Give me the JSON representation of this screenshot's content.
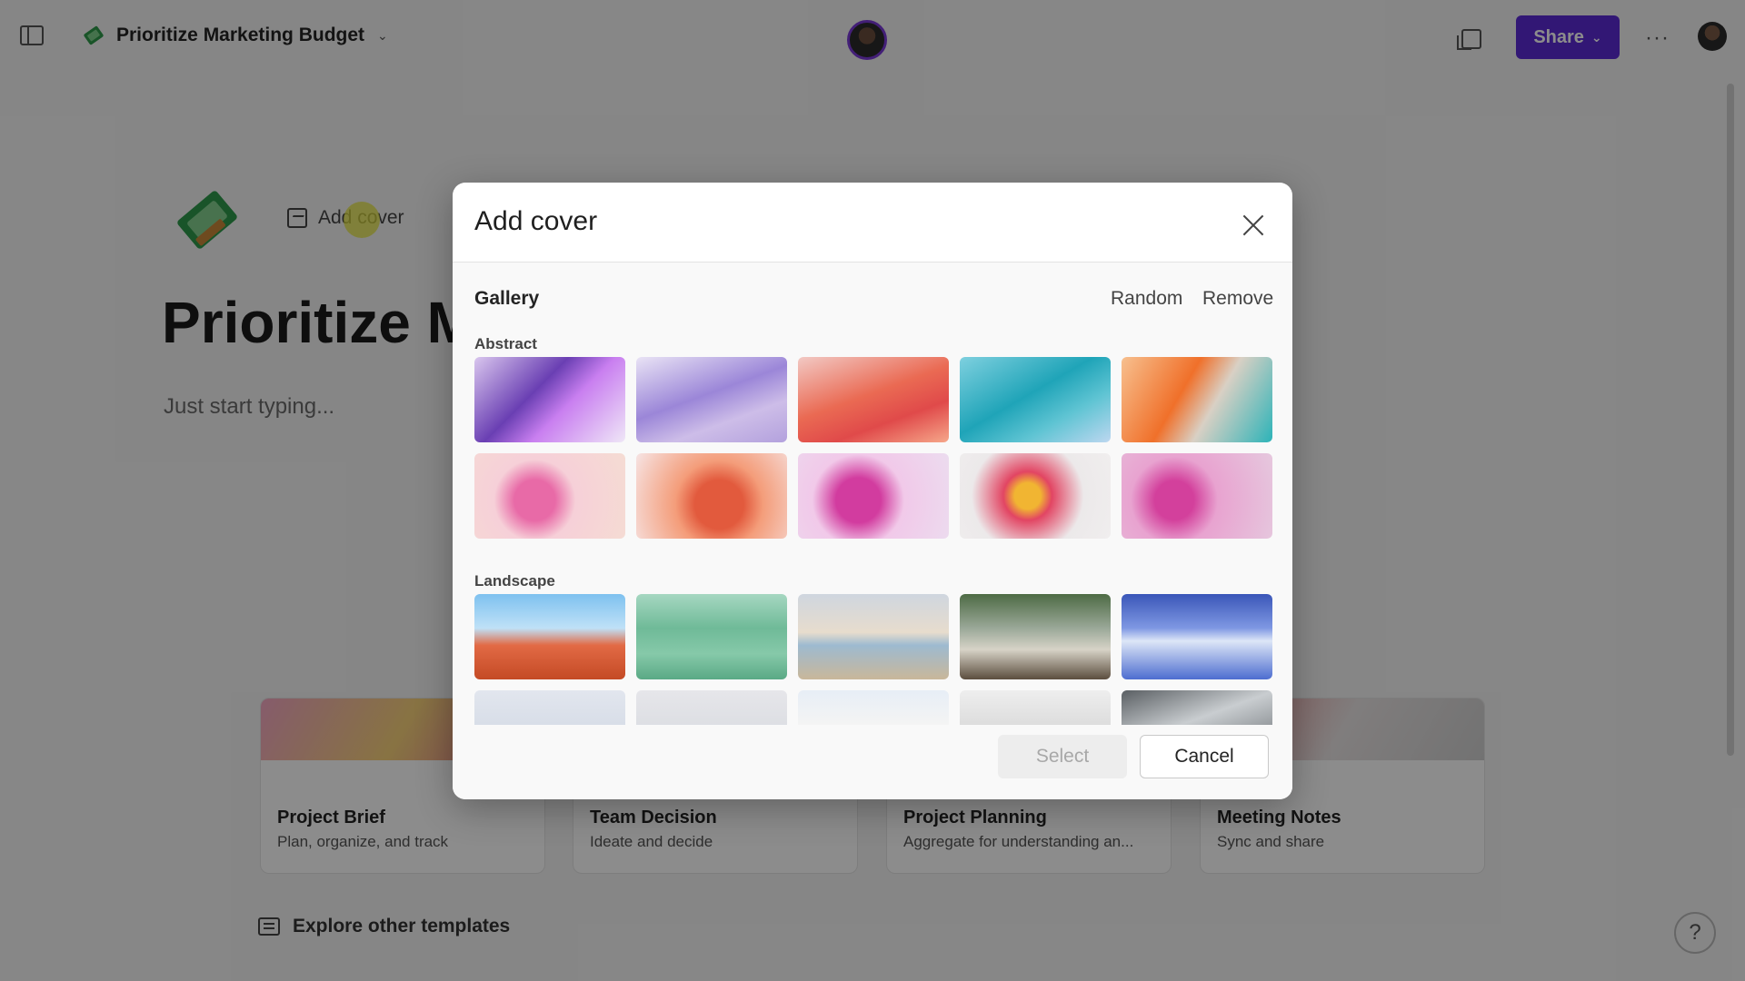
{
  "topbar": {
    "doc_title": "Prioritize Marketing Budget",
    "share_label": "Share"
  },
  "page": {
    "add_cover_label": "Add cover",
    "heading": "Prioritize Marketing Budget",
    "placeholder": "Just start typing..."
  },
  "templates": [
    {
      "title": "Project Brief",
      "desc": "Plan, organize, and track"
    },
    {
      "title": "Team Decision",
      "desc": "Ideate and decide"
    },
    {
      "title": "Project Planning",
      "desc": "Aggregate for understanding an..."
    },
    {
      "title": "Meeting Notes",
      "desc": "Sync and share"
    }
  ],
  "explore_label": "Explore other templates",
  "help_label": "?",
  "dialog": {
    "title": "Add cover",
    "gallery_label": "Gallery",
    "random_label": "Random",
    "remove_label": "Remove",
    "sections": [
      {
        "label": "Abstract"
      },
      {
        "label": "Landscape"
      }
    ],
    "select_label": "Select",
    "cancel_label": "Cancel"
  },
  "colors": {
    "accent": "#5b2bd6",
    "presence_ring": "#7a3ad9"
  }
}
